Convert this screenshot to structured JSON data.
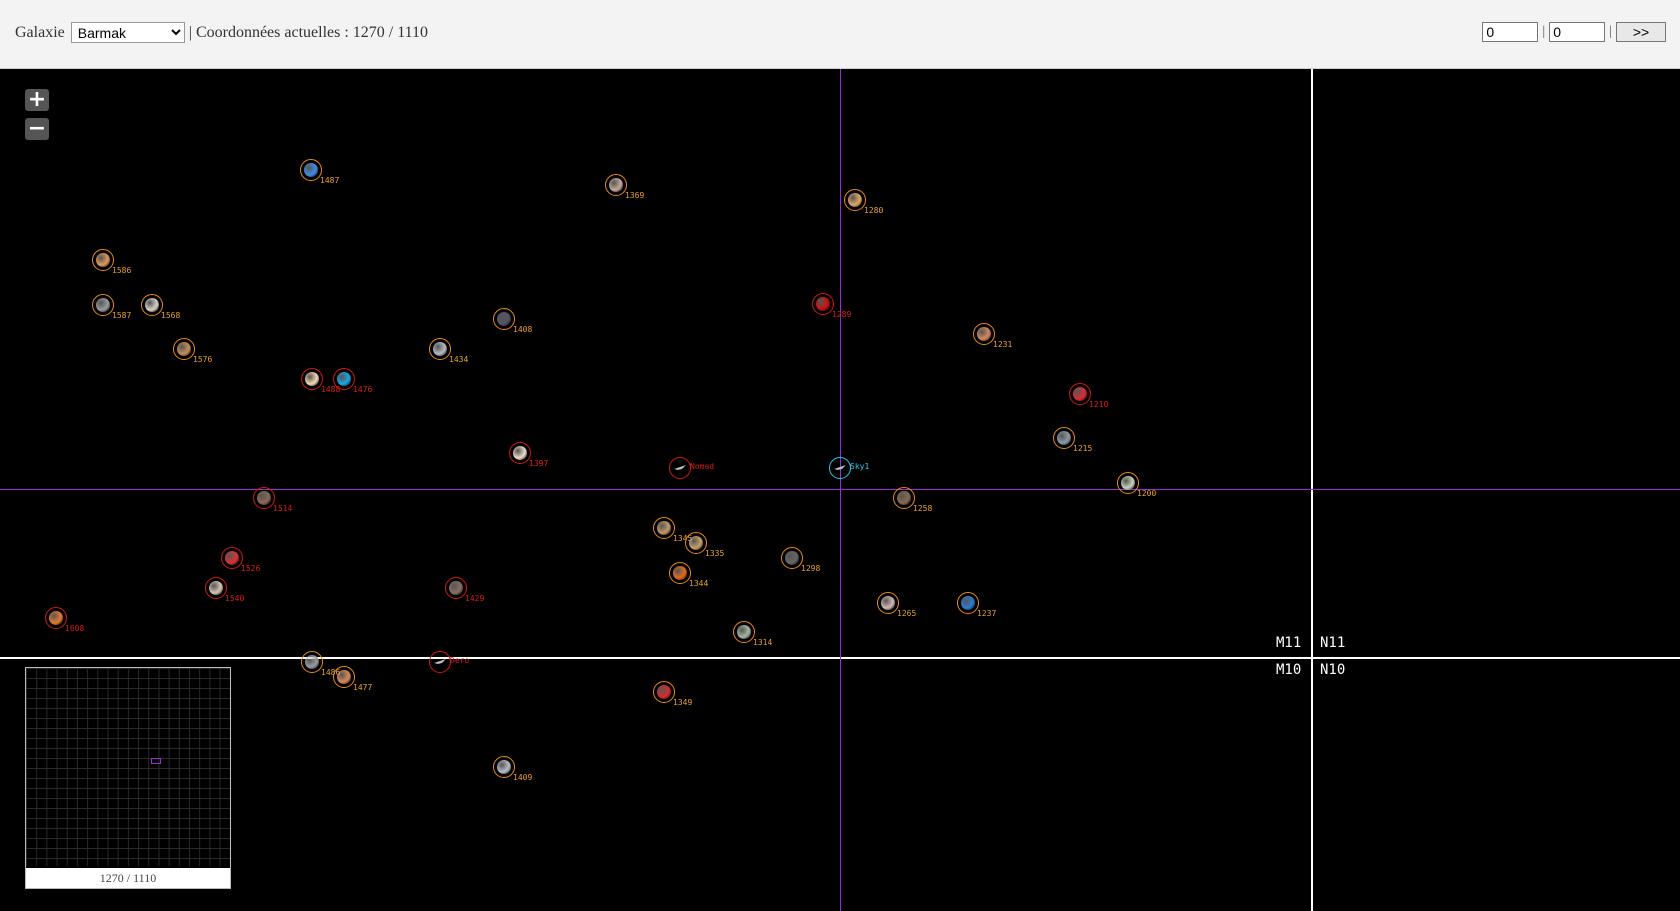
{
  "header": {
    "galaxy_label": "Galaxie",
    "galaxy_selected": "Barmak",
    "coords_text": "| Coordonnées actuelles : 1270 / 1110",
    "input_x": "0",
    "input_y": "0",
    "separator": "|",
    "go_label": ">>"
  },
  "map": {
    "zoom_in": "+",
    "zoom_out": "−",
    "sectors": [
      "M11",
      "N11",
      "M10",
      "N10"
    ],
    "bodies": [
      {
        "label": "1487",
        "ring": "orange",
        "color": "#3f8ee8"
      },
      {
        "label": "1369",
        "ring": "orange",
        "color": "#c7a79a"
      },
      {
        "label": "1280",
        "ring": "orange",
        "color": "#e2a868"
      },
      {
        "label": "1586",
        "ring": "orange",
        "color": "#e09a5a"
      },
      {
        "label": "1587",
        "ring": "orange",
        "color": "#9a9ba0"
      },
      {
        "label": "1568",
        "ring": "orange",
        "color": "#d8d2c8"
      },
      {
        "label": "1408",
        "ring": "orange",
        "color": "#556"
      },
      {
        "label": "1289",
        "ring": "red",
        "color": "#cc1010"
      },
      {
        "label": "1231",
        "ring": "orange",
        "color": "#d9885e"
      },
      {
        "label": "1576",
        "ring": "orange",
        "color": "#c89058"
      },
      {
        "label": "1434",
        "ring": "orange",
        "color": "#b6bcc6"
      },
      {
        "label": "1488",
        "ring": "red",
        "color": "#f2d9b0"
      },
      {
        "label": "1476",
        "ring": "red",
        "color": "#17a6e6"
      },
      {
        "label": "1210",
        "ring": "red",
        "color": "#e02a36"
      },
      {
        "label": "1215",
        "ring": "orange",
        "color": "#8c9aa8"
      },
      {
        "label": "1397",
        "ring": "red",
        "color": "#ecdcc8"
      },
      {
        "label": "Nomad",
        "ring": "red",
        "color": "#777"
      },
      {
        "label": "Sky1",
        "ring": "cyan",
        "color": "#666"
      },
      {
        "label": "1200",
        "ring": "orange",
        "color": "#c6d2b8"
      },
      {
        "label": "1514",
        "ring": "red",
        "color": "#8b6a52"
      },
      {
        "label": "1258",
        "ring": "orange",
        "color": "#8a6a4e"
      },
      {
        "label": "1345",
        "ring": "orange",
        "color": "#c69868"
      },
      {
        "label": "1335",
        "ring": "orange",
        "color": "#c8a06a"
      },
      {
        "label": "1526",
        "ring": "red",
        "color": "#e03030"
      },
      {
        "label": "1298",
        "ring": "orange",
        "color": "#666"
      },
      {
        "label": "1344",
        "ring": "orange",
        "color": "#e86a20"
      },
      {
        "label": "1540",
        "ring": "red",
        "color": "#d8c4b0"
      },
      {
        "label": "1429",
        "ring": "red",
        "color": "#8a7060"
      },
      {
        "label": "1265",
        "ring": "orange",
        "color": "#d4b8b0"
      },
      {
        "label": "1237",
        "ring": "orange",
        "color": "#2b7cd8"
      },
      {
        "label": "1608",
        "ring": "red",
        "color": "#e87a30"
      },
      {
        "label": "1314",
        "ring": "orange",
        "color": "#a8b8a0"
      },
      {
        "label": "1486",
        "ring": "orange",
        "color": "#9a9ba0"
      },
      {
        "label": "1477",
        "ring": "orange",
        "color": "#d98a5a"
      },
      {
        "label": "Dero",
        "ring": "red",
        "color": "#777"
      },
      {
        "label": "1349",
        "ring": "orange",
        "color": "#e02a2a"
      },
      {
        "label": "1409",
        "ring": "orange",
        "color": "#b8bcc4"
      }
    ]
  },
  "minimap": {
    "coords": "1270 / 1110"
  }
}
